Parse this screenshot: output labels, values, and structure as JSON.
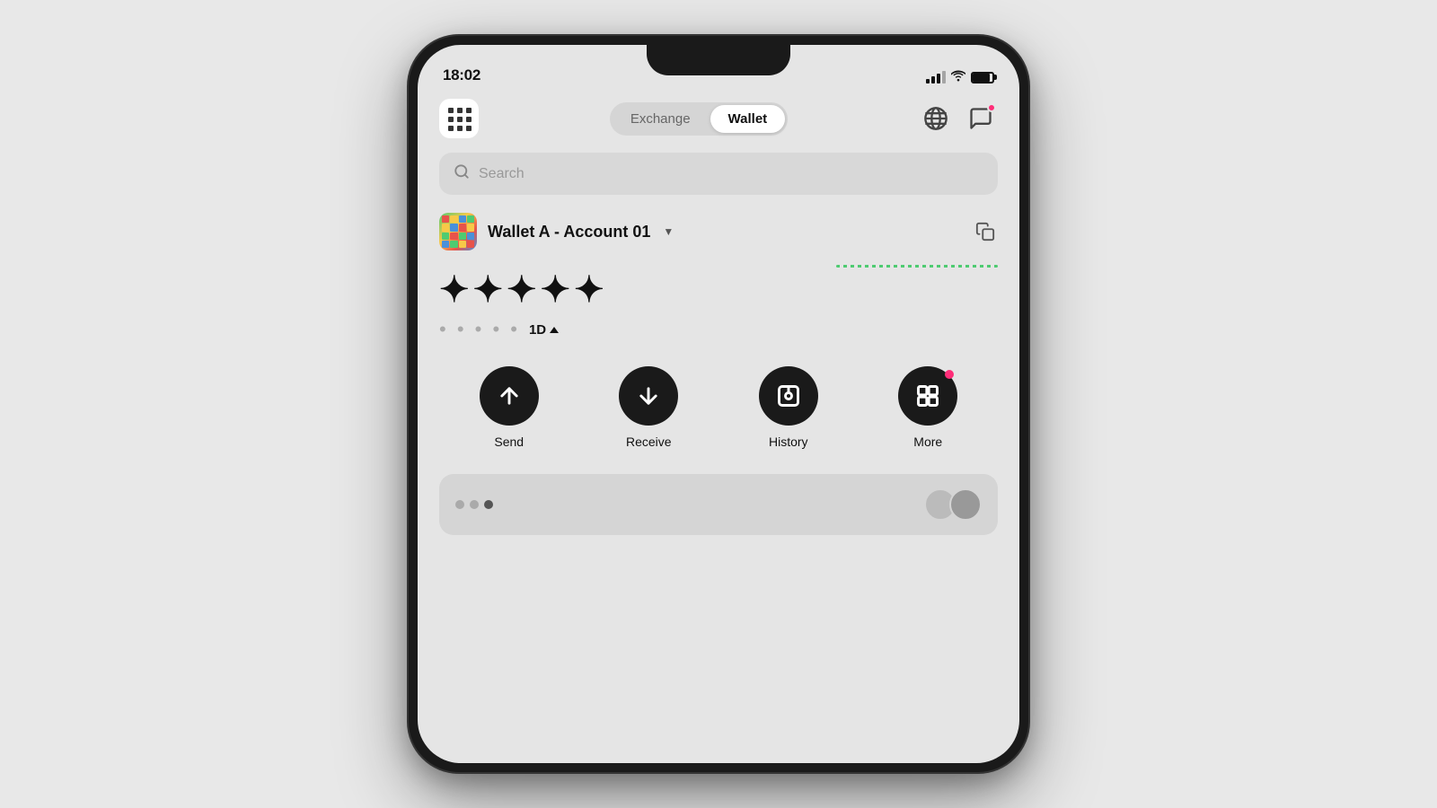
{
  "page": {
    "background": "#e8e8e8"
  },
  "status_bar": {
    "time": "18:02"
  },
  "nav": {
    "tab_exchange": "Exchange",
    "tab_wallet": "Wallet",
    "active_tab": "wallet"
  },
  "search": {
    "placeholder": "Search"
  },
  "wallet": {
    "account_name": "Wallet A - Account 01",
    "balance_hidden": "✦✦✦✦✦",
    "sub_balance_hidden": "• • • • •",
    "period": "1D",
    "trend": "up"
  },
  "actions": {
    "send_label": "Send",
    "receive_label": "Receive",
    "history_label": "History",
    "more_label": "More"
  }
}
